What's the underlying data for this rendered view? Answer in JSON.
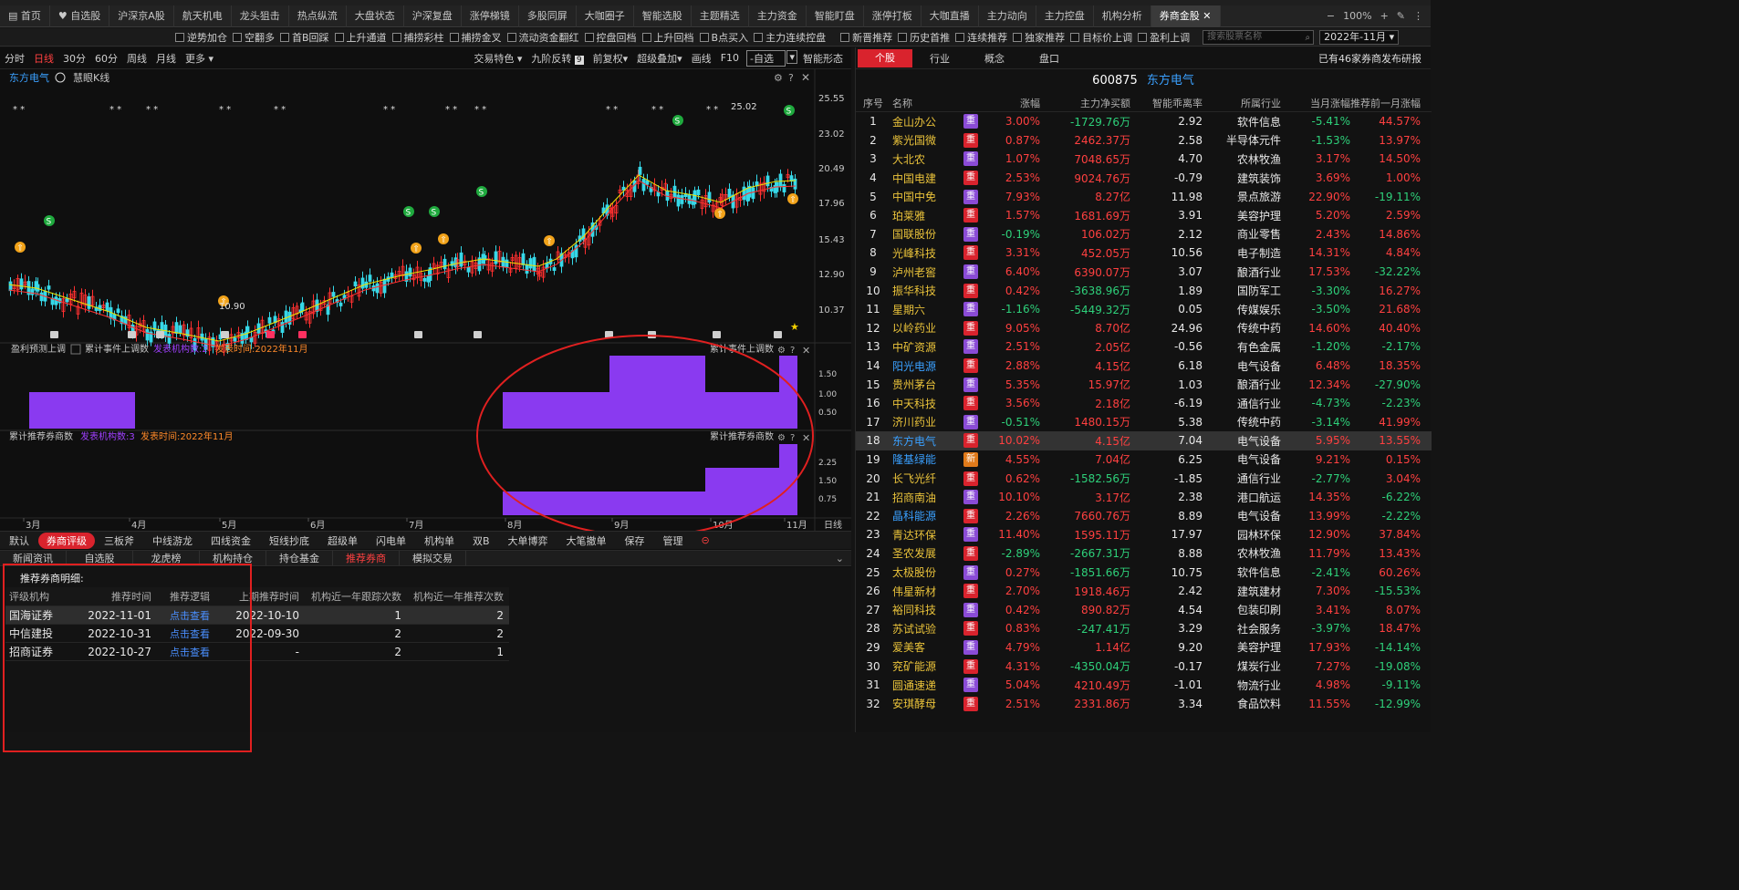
{
  "tabbar": {
    "tabs": [
      "首页",
      "自选股",
      "沪深京A股",
      "航天机电",
      "龙头狙击",
      "热点纵流",
      "大盘状态",
      "沪深复盘",
      "涨停梯镜",
      "多股同屏",
      "大咖圈子",
      "智能选股",
      "主题精选",
      "主力资金",
      "智能盯盘",
      "涨停打板",
      "大咖直播",
      "主力动向",
      "主力控盘",
      "机构分析",
      "券商金股"
    ],
    "zoom": "100%"
  },
  "filters": {
    "checkboxes": [
      "逆势加仓",
      "空翻多",
      "首B回踩",
      "上升通道",
      "捕捞彩柱",
      "捕捞金叉",
      "流动资金翻红",
      "控盘回档",
      "上升回档",
      "B点买入",
      "主力连续控盘",
      "新晋推荐",
      "历史首推",
      "连续推荐",
      "独家推荐",
      "目标价上调",
      "盈利上调"
    ],
    "search_placeholder": "搜索股票名称",
    "date": "2022年-11月"
  },
  "chart_toolbar": {
    "left": [
      "分时",
      "日线",
      "30分",
      "60分",
      "周线",
      "月线",
      "更多 ▾"
    ],
    "right": [
      "交易特色 ▾",
      "九阶反转",
      "前复权▾",
      "超级叠加▾",
      "画线",
      "F10"
    ],
    "selfpick": "-自选",
    "smart": "智能形态"
  },
  "chart": {
    "stock_name": "东方电气",
    "indicator": "慧眼K线",
    "y_ticks": [
      "25.55",
      "23.02",
      "20.49",
      "17.96",
      "15.43",
      "12.90",
      "10.37"
    ],
    "x_ticks": [
      "3月",
      "4月",
      "5月",
      "6月",
      "7月",
      "8月",
      "9月",
      "10月",
      "11月"
    ],
    "axis_label": "日线",
    "high_label": "25.02",
    "low_label": "10.90"
  },
  "sub1": {
    "title": "盈利预测上调",
    "dropdown": "累计事件上调数",
    "orgs": "发表机构数:2",
    "time": "发表时间:2022年11月",
    "right_label": "累计事件上调数",
    "ticks": [
      "1.50",
      "1.00",
      "0.50"
    ]
  },
  "sub2": {
    "title": "累计推荐券商数",
    "orgs": "发表机构数:3",
    "time": "发表时间:2022年11月",
    "right_label": "累计推荐券商数",
    "ticks": [
      "2.25",
      "1.50",
      "0.75"
    ]
  },
  "bottom_tabs": [
    "默认",
    "券商评级",
    "三板斧",
    "中线游龙",
    "四线资金",
    "短线抄底",
    "超级单",
    "闪电单",
    "机构单",
    "双B",
    "大单博弈",
    "大笔撤单",
    "保存",
    "管理"
  ],
  "info_tabs": [
    "新闻资讯",
    "自选股",
    "龙虎榜",
    "机构持仓",
    "持仓基金",
    "推荐券商",
    "模拟交易"
  ],
  "detail": {
    "title": "推荐券商明细:",
    "headers": [
      "评级机构",
      "推荐时间",
      "推荐逻辑",
      "上期推荐时间",
      "机构近一年跟踪次数",
      "机构近一年推荐次数"
    ],
    "rows": [
      [
        "国海证券",
        "2022-11-01",
        "点击查看",
        "2022-10-10",
        "1",
        "2"
      ],
      [
        "中信建投",
        "2022-10-31",
        "点击查看",
        "2022-09-30",
        "2",
        "2"
      ],
      [
        "招商证券",
        "2022-10-27",
        "点击查看",
        "-",
        "2",
        "1"
      ]
    ]
  },
  "right_panel": {
    "tabs": [
      "个股",
      "行业",
      "概念",
      "盘口"
    ],
    "note": "已有46家券商发布研报",
    "code": "600875",
    "name": "东方电气",
    "headers": [
      "序号",
      "名称",
      "",
      "涨幅",
      "主力净买额",
      "智能乖离率",
      "所属行业",
      "当月涨幅",
      "推荐前一月涨幅"
    ],
    "rows": [
      [
        "1",
        "金山办公",
        "重",
        "3.00%",
        "-1729.76万",
        "2.92",
        "软件信息",
        "-5.41%",
        "44.57%"
      ],
      [
        "2",
        "紫光国微",
        "重",
        "0.87%",
        "2462.37万",
        "2.58",
        "半导体元件",
        "-1.53%",
        "13.97%"
      ],
      [
        "3",
        "大北农",
        "重",
        "1.07%",
        "7048.65万",
        "4.70",
        "农林牧渔",
        "3.17%",
        "14.50%"
      ],
      [
        "4",
        "中国电建",
        "重",
        "2.53%",
        "9024.76万",
        "-0.79",
        "建筑装饰",
        "3.69%",
        "1.00%"
      ],
      [
        "5",
        "中国中免",
        "重",
        "7.93%",
        "8.27亿",
        "11.98",
        "景点旅游",
        "22.90%",
        "-19.11%"
      ],
      [
        "6",
        "珀莱雅",
        "重",
        "1.57%",
        "1681.69万",
        "3.91",
        "美容护理",
        "5.20%",
        "2.59%"
      ],
      [
        "7",
        "国联股份",
        "重",
        "-0.19%",
        "106.02万",
        "2.12",
        "商业零售",
        "2.43%",
        "14.86%"
      ],
      [
        "8",
        "光峰科技",
        "重",
        "3.31%",
        "452.05万",
        "10.56",
        "电子制造",
        "14.31%",
        "4.84%"
      ],
      [
        "9",
        "泸州老窖",
        "重",
        "6.40%",
        "6390.07万",
        "3.07",
        "酿酒行业",
        "17.53%",
        "-32.22%"
      ],
      [
        "10",
        "振华科技",
        "重",
        "0.42%",
        "-3638.96万",
        "1.89",
        "国防军工",
        "-3.30%",
        "16.27%"
      ],
      [
        "11",
        "星期六",
        "重",
        "-1.16%",
        "-5449.32万",
        "0.05",
        "传媒娱乐",
        "-3.50%",
        "21.68%"
      ],
      [
        "12",
        "以岭药业",
        "重",
        "9.05%",
        "8.70亿",
        "24.96",
        "传统中药",
        "14.60%",
        "40.40%"
      ],
      [
        "13",
        "中矿资源",
        "重",
        "2.51%",
        "2.05亿",
        "-0.56",
        "有色金属",
        "-1.20%",
        "-2.17%"
      ],
      [
        "14",
        "阳光电源",
        "重",
        "2.88%",
        "4.15亿",
        "6.18",
        "电气设备",
        "6.48%",
        "18.35%"
      ],
      [
        "15",
        "贵州茅台",
        "重",
        "5.35%",
        "15.97亿",
        "1.03",
        "酿酒行业",
        "12.34%",
        "-27.90%"
      ],
      [
        "16",
        "中天科技",
        "重",
        "3.56%",
        "2.18亿",
        "-6.19",
        "通信行业",
        "-4.73%",
        "-2.23%"
      ],
      [
        "17",
        "济川药业",
        "重",
        "-0.51%",
        "1480.15万",
        "5.38",
        "传统中药",
        "-3.14%",
        "41.99%"
      ],
      [
        "18",
        "东方电气",
        "重",
        "10.02%",
        "4.15亿",
        "7.04",
        "电气设备",
        "5.95%",
        "13.55%"
      ],
      [
        "19",
        "隆基绿能",
        "新",
        "4.55%",
        "7.04亿",
        "6.25",
        "电气设备",
        "9.21%",
        "0.15%"
      ],
      [
        "20",
        "长飞光纤",
        "重",
        "0.62%",
        "-1582.56万",
        "-1.85",
        "通信行业",
        "-2.77%",
        "3.04%"
      ],
      [
        "21",
        "招商南油",
        "重",
        "10.10%",
        "3.17亿",
        "2.38",
        "港口航运",
        "14.35%",
        "-6.22%"
      ],
      [
        "22",
        "晶科能源",
        "重",
        "2.26%",
        "7660.76万",
        "8.89",
        "电气设备",
        "13.99%",
        "-2.22%"
      ],
      [
        "23",
        "青达环保",
        "重",
        "11.40%",
        "1595.11万",
        "17.97",
        "园林环保",
        "12.90%",
        "37.84%"
      ],
      [
        "24",
        "圣农发展",
        "重",
        "-2.89%",
        "-2667.31万",
        "8.88",
        "农林牧渔",
        "11.79%",
        "13.43%"
      ],
      [
        "25",
        "太极股份",
        "重",
        "0.27%",
        "-1851.66万",
        "10.75",
        "软件信息",
        "-2.41%",
        "60.26%"
      ],
      [
        "26",
        "伟星新材",
        "重",
        "2.70%",
        "1918.46万",
        "2.42",
        "建筑建材",
        "7.30%",
        "-15.53%"
      ],
      [
        "27",
        "裕同科技",
        "重",
        "0.42%",
        "890.82万",
        "4.54",
        "包装印刷",
        "3.41%",
        "8.07%"
      ],
      [
        "28",
        "苏试试验",
        "重",
        "0.83%",
        "-247.41万",
        "3.29",
        "社会服务",
        "-3.97%",
        "18.47%"
      ],
      [
        "29",
        "爱美客",
        "重",
        "4.79%",
        "1.14亿",
        "9.20",
        "美容护理",
        "17.93%",
        "-14.14%"
      ],
      [
        "30",
        "兖矿能源",
        "重",
        "4.31%",
        "-4350.04万",
        "-0.17",
        "煤炭行业",
        "7.27%",
        "-19.08%"
      ],
      [
        "31",
        "圆通速递",
        "重",
        "5.04%",
        "4210.49万",
        "-1.01",
        "物流行业",
        "4.98%",
        "-9.11%"
      ],
      [
        "32",
        "安琪酵母",
        "重",
        "2.51%",
        "2331.86万",
        "3.34",
        "食品饮料",
        "11.55%",
        "-12.99%"
      ]
    ]
  }
}
